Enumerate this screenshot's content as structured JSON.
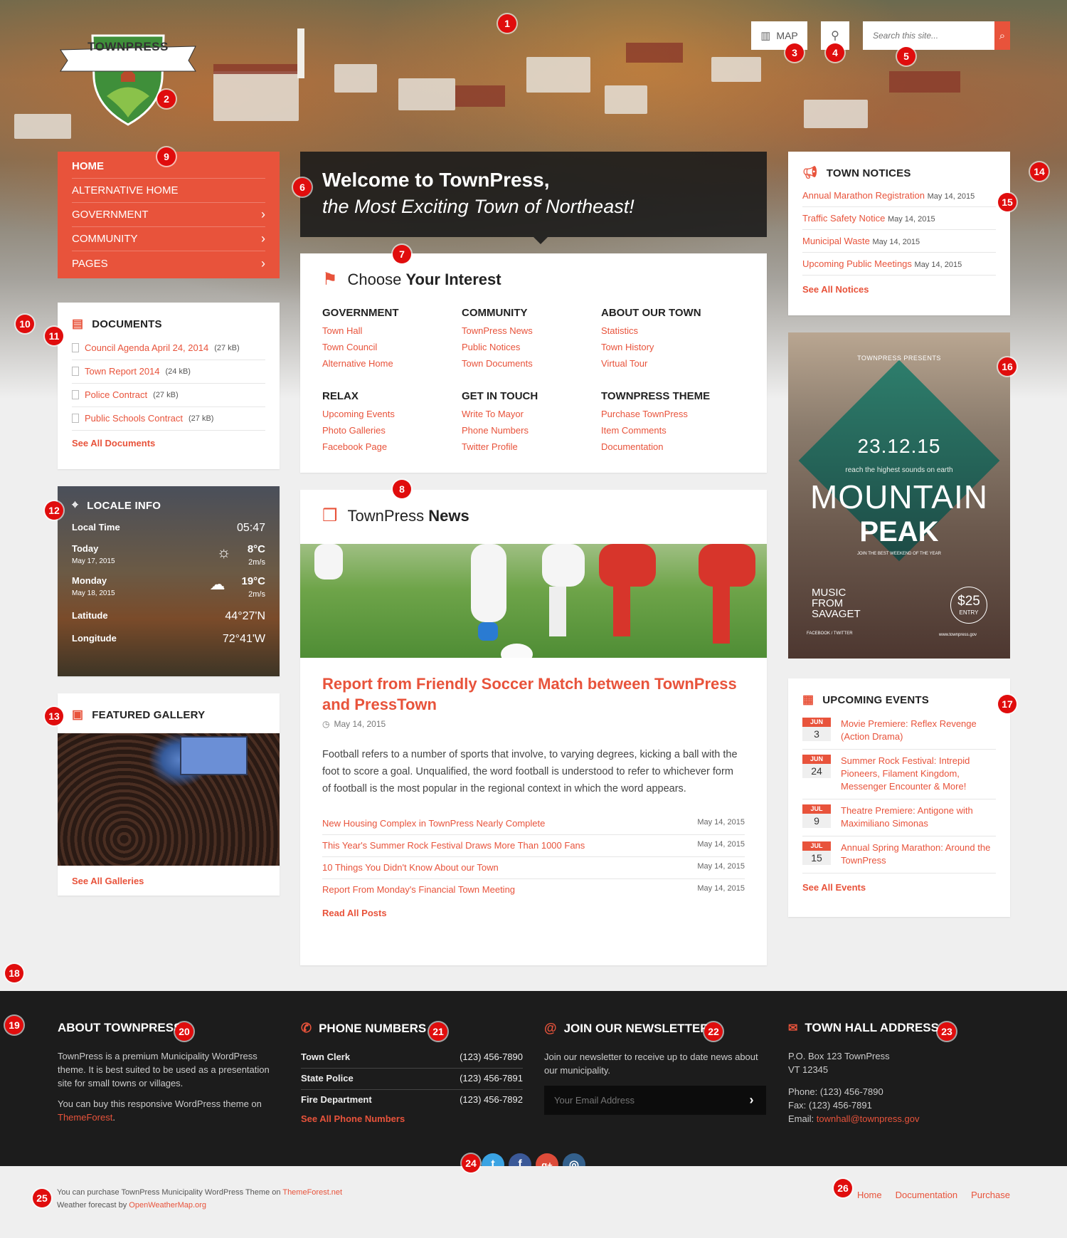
{
  "brand": {
    "logo_text": "TOWNPRESS"
  },
  "header": {
    "map_label": "MAP",
    "search_placeholder": "Search this site..."
  },
  "nav": {
    "items": [
      {
        "label": "HOME",
        "arrow": ""
      },
      {
        "label": "ALTERNATIVE HOME",
        "arrow": ""
      },
      {
        "label": "GOVERNMENT",
        "arrow": "›"
      },
      {
        "label": "COMMUNITY",
        "arrow": "›"
      },
      {
        "label": "PAGES",
        "arrow": "›"
      }
    ]
  },
  "documents": {
    "title": "DOCUMENTS",
    "items": [
      {
        "name": "Council Agenda April 24, 2014",
        "size": "(27 kB)"
      },
      {
        "name": "Town Report 2014",
        "size": "(24 kB)"
      },
      {
        "name": "Police Contract",
        "size": "(27 kB)"
      },
      {
        "name": "Public Schools Contract",
        "size": "(27 kB)"
      }
    ],
    "see_all": "See All Documents"
  },
  "locale": {
    "title": "LOCALE INFO",
    "local_time_label": "Local Time",
    "local_time": "05:47",
    "today_label": "Today",
    "today_date": "May 17, 2015",
    "today_temp": "8°C",
    "today_wind": "2m/s",
    "monday_label": "Monday",
    "monday_date": "May 18, 2015",
    "monday_temp": "19°C",
    "monday_wind": "2m/s",
    "latitude_label": "Latitude",
    "latitude": "44°27'N",
    "longitude_label": "Longitude",
    "longitude": "72°41'W"
  },
  "gallery": {
    "title": "FEATURED GALLERY",
    "see_all": "See All Galleries"
  },
  "welcome": {
    "line1": "Welcome to TownPress,",
    "line2": "the Most Exciting Town of Northeast!"
  },
  "interest": {
    "title_light": "Choose",
    "title_bold": "Your Interest",
    "columns": [
      {
        "heading": "GOVERNMENT",
        "links": [
          "Town Hall",
          "Town Council",
          "Alternative Home"
        ]
      },
      {
        "heading": "COMMUNITY",
        "links": [
          "TownPress News",
          "Public Notices",
          "Town Documents"
        ]
      },
      {
        "heading": "ABOUT OUR TOWN",
        "links": [
          "Statistics",
          "Town History",
          "Virtual Tour"
        ]
      },
      {
        "heading": "RELAX",
        "links": [
          "Upcoming Events",
          "Photo Galleries",
          "Facebook Page"
        ]
      },
      {
        "heading": "GET IN TOUCH",
        "links": [
          "Write To Mayor",
          "Phone Numbers",
          "Twitter Profile"
        ]
      },
      {
        "heading": "TOWNPRESS THEME",
        "links": [
          "Purchase TownPress",
          "Item Comments",
          "Documentation"
        ]
      }
    ]
  },
  "news": {
    "title_light": "TownPress",
    "title_bold": "News",
    "headline": "Report from Friendly Soccer Match between TownPress and PressTown",
    "date": "May 14, 2015",
    "body": "Football refers to a number of sports that involve, to varying degrees, kicking a ball with the foot to score a goal. Unqualified, the word football is understood to refer to whichever form of football is the most popular in the regional context in which the word appears.",
    "items": [
      {
        "title": "New Housing Complex in TownPress Nearly Complete",
        "date": "May 14, 2015"
      },
      {
        "title": "This Year's Summer Rock Festival Draws More Than 1000 Fans",
        "date": "May 14, 2015"
      },
      {
        "title": "10 Things You Didn't Know About our Town",
        "date": "May 14, 2015"
      },
      {
        "title": "Report From Monday's Financial Town Meeting",
        "date": "May 14, 2015"
      }
    ],
    "read_all": "Read All Posts"
  },
  "notices": {
    "title": "TOWN NOTICES",
    "items": [
      {
        "title": "Annual Marathon Registration",
        "date": "May 14, 2015"
      },
      {
        "title": "Traffic Safety Notice",
        "date": "May 14, 2015"
      },
      {
        "title": "Municipal Waste",
        "date": "May 14, 2015"
      },
      {
        "title": "Upcoming Public Meetings",
        "date": "May 14, 2015"
      }
    ],
    "see_all": "See All Notices"
  },
  "poster": {
    "presents": "TOWNPRESS PRESENTS",
    "date": "23.12.15",
    "tagline": "reach the highest sounds on earth",
    "line1": "MOUNTAIN",
    "line2": "PEAK",
    "sub": "JOIN THE BEST WEEKEND OF THE YEAR",
    "music": "MUSIC FROM SAVAGET",
    "social": "FACEBOOK / TWITTER",
    "price": "$25",
    "price_sub": "ENTRY",
    "url": "www.townpress.gov"
  },
  "events": {
    "title": "UPCOMING EVENTS",
    "items": [
      {
        "month": "JUN",
        "day": "3",
        "title": "Movie Premiere: Reflex Revenge (Action Drama)"
      },
      {
        "month": "JUN",
        "day": "24",
        "title": "Summer Rock Festival: Intrepid Pioneers, Filament Kingdom, Messenger Encounter & More!"
      },
      {
        "month": "JUL",
        "day": "9",
        "title": "Theatre Premiere: Antigone with Maximiliano Simonas"
      },
      {
        "month": "JUL",
        "day": "15",
        "title": "Annual Spring Marathon: Around the TownPress"
      }
    ],
    "see_all": "See All Events"
  },
  "footer": {
    "about_title": "ABOUT TOWNPRESS",
    "about_p1": "TownPress is a premium Municipality WordPress theme. It is best suited to be used as a presentation site for small towns or villages.",
    "about_p2": "You can buy this responsive WordPress theme on",
    "about_link": "ThemeForest",
    "phones_title": "PHONE NUMBERS",
    "phones": [
      {
        "label": "Town Clerk",
        "number": "(123) 456-7890"
      },
      {
        "label": "State Police",
        "number": "(123) 456-7891"
      },
      {
        "label": "Fire Department",
        "number": "(123) 456-7892"
      }
    ],
    "phones_see_all": "See All Phone Numbers",
    "newsletter_title": "JOIN OUR NEWSLETTER",
    "newsletter_text": "Join our newsletter to receive up to date news about our municipality.",
    "newsletter_placeholder": "Your Email Address",
    "address_title": "TOWN HALL ADDRESS",
    "address_line1": "P.O. Box 123 TownPress",
    "address_line2": "VT 12345",
    "address_phone": "Phone: (123) 456-7890",
    "address_fax": "Fax: (123) 456-7891",
    "address_email_label": "Email:",
    "address_email": "townhall@townpress.gov"
  },
  "bottom": {
    "line1_text": "You can purchase TownPress Municipality WordPress Theme on",
    "line1_link": "ThemeForest.net",
    "line2_text": "Weather forecast by",
    "line2_link": "OpenWeatherMap.org",
    "links": [
      "Home",
      "Documentation",
      "Purchase"
    ]
  },
  "social": [
    "t",
    "f",
    "g+",
    "◎"
  ],
  "annotations": [
    "1",
    "2",
    "3",
    "4",
    "5",
    "6",
    "7",
    "8",
    "9",
    "10",
    "11",
    "12",
    "13",
    "14",
    "15",
    "16",
    "17",
    "18",
    "19",
    "20",
    "21",
    "22",
    "23",
    "24",
    "25",
    "26"
  ],
  "colors": {
    "accent": "#e8533b",
    "badge": "#e00d0d",
    "footer": "#1c1c1c"
  }
}
